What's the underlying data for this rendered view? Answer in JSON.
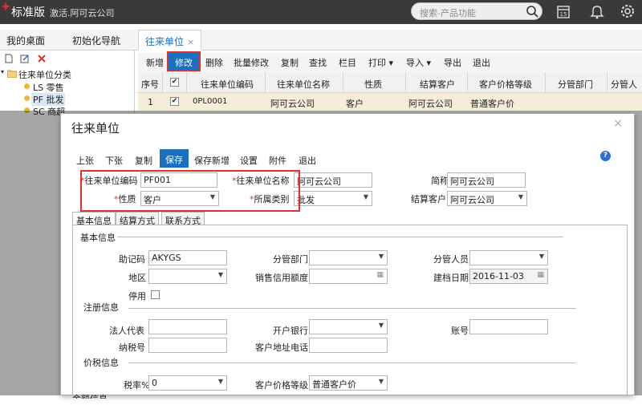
{
  "topbar": {
    "brand": "标准版",
    "activate": "激活.阿可云公司",
    "search_placeholder": "搜索-产品功能",
    "calendar_day": "15"
  },
  "tabs": [
    {
      "label": "我的桌面"
    },
    {
      "label": "初始化导航"
    },
    {
      "label": "往来单位",
      "close": "×"
    }
  ],
  "tree": {
    "root": "往来单位分类",
    "items": [
      "LS 零售",
      "PF 批发",
      "SC 商超"
    ]
  },
  "toolbar": [
    "新增",
    "修改",
    "删除",
    "批量修改",
    "复制",
    "查找",
    "栏目",
    "打印 ▾",
    "导入 ▾",
    "导出",
    "退出"
  ],
  "grid": {
    "headers": [
      "序号",
      "",
      "往来单位编码",
      "往来单位名称",
      "性质",
      "结算客户",
      "客户价格等级",
      "分管部门",
      "分管人"
    ],
    "row": {
      "seq": "1",
      "code": "0PL0001",
      "name": "阿可云公司",
      "nature": "客户",
      "settle": "阿可云公司",
      "price_level": "普通客户价"
    }
  },
  "dialog": {
    "title": "往来单位",
    "close": "×",
    "toolbar": [
      "上张",
      "下张",
      "复制",
      "保存",
      "保存新增",
      "设置",
      "附件",
      "退出"
    ],
    "help": "?",
    "fields": {
      "code_label": "往来单位编码",
      "code_value": "PF001",
      "name_label": "往来单位名称",
      "name_value": "阿可云公司",
      "short_label": "简称",
      "short_value": "阿可云公司",
      "nature_label": "性质",
      "nature_value": "客户",
      "category_label": "所属类别",
      "category_value": "批发",
      "settle_label": "结算客户",
      "settle_value": "阿可云公司"
    },
    "subtabs": [
      "基本信息",
      "结算方式",
      "联系方式"
    ],
    "basic": {
      "section": "基本信息",
      "mnemonic_label": "助记码",
      "mnemonic_value": "AKYGS",
      "dept_label": "分管部门",
      "person_label": "分管人员",
      "region_label": "地区",
      "credit_label": "销售信用额度",
      "date_label": "建档日期",
      "date_value": "2016-11-03",
      "disable_label": "停用"
    },
    "reg": {
      "section": "注册信息",
      "legal_label": "法人代表",
      "bank_label": "开户银行",
      "account_label": "账号",
      "tax_label": "纳税号",
      "addr_label": "客户地址电话"
    },
    "price": {
      "section": "价税信息",
      "rate_label": "税率%",
      "rate_value": "0",
      "level_label": "客户价格等级",
      "level_value": "普通客户价"
    },
    "amount": {
      "section": "金额信息"
    }
  }
}
